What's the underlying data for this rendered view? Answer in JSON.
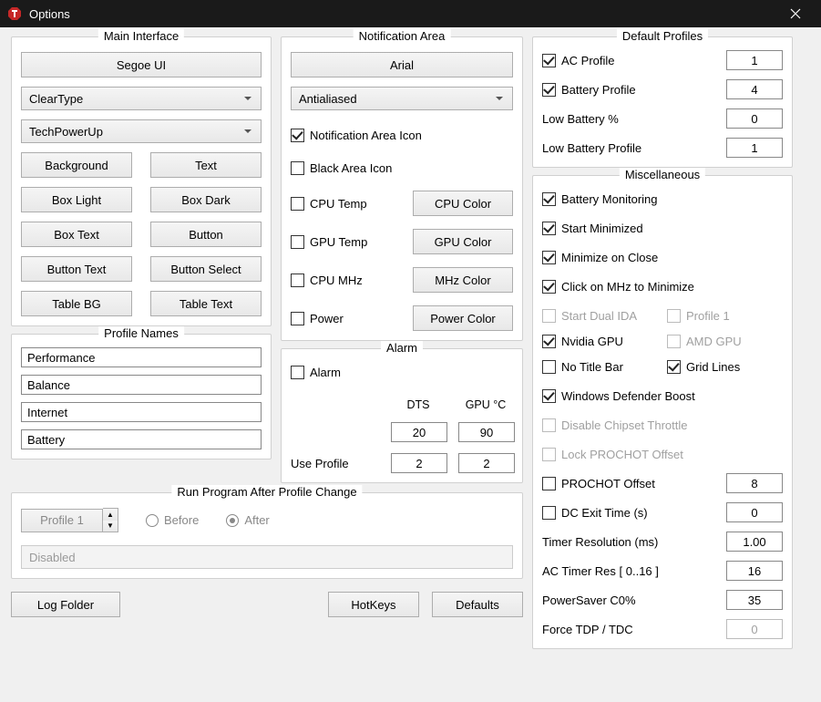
{
  "window": {
    "title": "Options"
  },
  "main_interface": {
    "title": "Main Interface",
    "font_button": "Segoe UI",
    "render_mode": "ClearType",
    "brand": "TechPowerUp",
    "buttons": {
      "background": "Background",
      "text": "Text",
      "box_light": "Box Light",
      "box_dark": "Box Dark",
      "box_text": "Box Text",
      "button": "Button",
      "button_text": "Button Text",
      "button_select": "Button Select",
      "table_bg": "Table BG",
      "table_text": "Table Text"
    }
  },
  "profile_names": {
    "title": "Profile Names",
    "values": [
      "Performance",
      "Balance",
      "Internet",
      "Battery"
    ]
  },
  "notification_area": {
    "title": "Notification Area",
    "font_button": "Arial",
    "aa_mode": "Antialiased",
    "notif_icon_label": "Notification Area Icon",
    "black_icon_label": "Black Area Icon",
    "cpu_temp": "CPU Temp",
    "cpu_color": "CPU Color",
    "gpu_temp": "GPU Temp",
    "gpu_color": "GPU Color",
    "cpu_mhz": "CPU MHz",
    "mhz_color": "MHz Color",
    "power": "Power",
    "power_color": "Power Color"
  },
  "alarm": {
    "title": "Alarm",
    "alarm_label": "Alarm",
    "dts_label": "DTS",
    "gpu_label": "GPU °C",
    "use_profile_label": "Use Profile",
    "dts_value": "20",
    "gpu_value": "90",
    "dts_profile": "2",
    "gpu_profile": "2"
  },
  "run_after": {
    "title": "Run Program After Profile Change",
    "profile_label": "Profile 1",
    "before": "Before",
    "after": "After",
    "disabled_text": "Disabled"
  },
  "bottom": {
    "log_folder": "Log Folder",
    "hotkeys": "HotKeys",
    "defaults": "Defaults"
  },
  "default_profiles": {
    "title": "Default Profiles",
    "ac_profile": "AC Profile",
    "ac_value": "1",
    "battery_profile": "Battery Profile",
    "battery_value": "4",
    "low_battery_pct": "Low Battery %",
    "low_battery_pct_value": "0",
    "low_battery_profile": "Low Battery Profile",
    "low_battery_profile_value": "1"
  },
  "misc": {
    "title": "Miscellaneous",
    "battery_monitoring": "Battery Monitoring",
    "start_minimized": "Start Minimized",
    "minimize_on_close": "Minimize on Close",
    "click_mhz": "Click on MHz to Minimize",
    "start_dual_ida": "Start Dual IDA",
    "profile1": "Profile 1",
    "nvidia_gpu": "Nvidia GPU",
    "amd_gpu": "AMD GPU",
    "no_title_bar": "No Title Bar",
    "grid_lines": "Grid Lines",
    "win_defender": "Windows Defender Boost",
    "disable_chipset": "Disable Chipset Throttle",
    "lock_prochot": "Lock PROCHOT Offset",
    "prochot_offset": "PROCHOT Offset",
    "prochot_value": "8",
    "dc_exit": "DC Exit Time (s)",
    "dc_exit_value": "0",
    "timer_res": "Timer Resolution (ms)",
    "timer_res_value": "1.00",
    "ac_timer": "AC Timer Res [ 0..16 ]",
    "ac_timer_value": "16",
    "powersaver": "PowerSaver C0%",
    "powersaver_value": "35",
    "force_tdp": "Force TDP / TDC",
    "force_tdp_value": "0"
  }
}
